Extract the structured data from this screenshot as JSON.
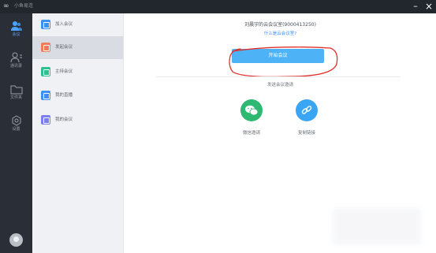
{
  "window": {
    "title": "小鱼易连",
    "minimize_glyph": "–",
    "close_glyph": "×"
  },
  "nav": {
    "items": [
      {
        "label": "会议",
        "icon": "people-icon",
        "active": true
      },
      {
        "label": "通讯录",
        "icon": "contacts-icon",
        "active": false
      },
      {
        "label": "文件夹",
        "icon": "folder-icon",
        "active": false
      },
      {
        "label": "设置",
        "icon": "gear-icon",
        "active": false
      }
    ]
  },
  "submenu": {
    "items": [
      {
        "label": "加入会议",
        "color": "#3d8ef5",
        "active": false
      },
      {
        "label": "发起会议",
        "color": "#f07d5a",
        "active": true
      },
      {
        "label": "主持会议",
        "color": "#2dbf8d",
        "active": false
      },
      {
        "label": "我的直播",
        "color": "#3d8ef5",
        "active": false
      },
      {
        "label": "我的会议",
        "color": "#7b7ff0",
        "active": false
      }
    ]
  },
  "main": {
    "meeting_title": "刘晨宇的云会议室(9000413250)",
    "help_link": "什么是云会议室?",
    "start_button": "开始会议",
    "invite_title": "发送会议邀请",
    "share": [
      {
        "label": "微信邀请",
        "icon": "wechat-icon",
        "color": "#2eb872"
      },
      {
        "label": "复制链接",
        "icon": "link-icon",
        "color": "#3aa5f2"
      }
    ]
  },
  "colors": {
    "accent": "#4eb2f6",
    "annotation": "#e0302a",
    "sidebar_dark": "#2a2f37"
  }
}
